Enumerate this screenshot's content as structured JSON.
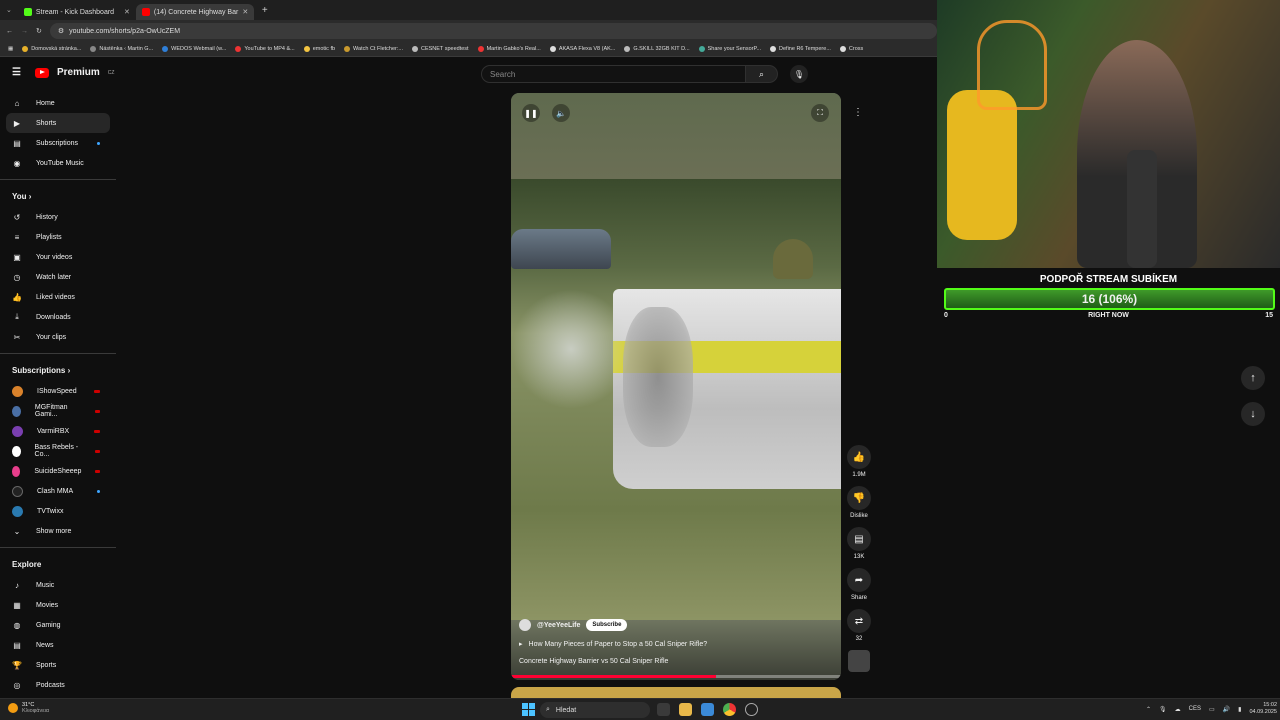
{
  "browser": {
    "tabs": [
      {
        "title": "Stream - Kick Dashboard",
        "icon": "kick-icon",
        "color": "#53fc18"
      },
      {
        "title": "(14) Concrete Highway Bar",
        "icon": "youtube-icon",
        "color": "#ff0000",
        "active": true
      }
    ],
    "url": "youtube.com/shorts/p2a-OwUcZEM",
    "bookmarks": [
      "Domovská stránka...",
      "Nástěnka ‹ Martin G...",
      "WEDOS Webmail (w...",
      "YouTube to MP4 &...",
      "emotic fb",
      "Watch Ct Fletcher:...",
      "CESNET speedtest",
      "Martin Gabko's Real...",
      "AKASA Flexa V8 (AK...",
      "G.SKILL 32GB KIT D...",
      "Share your SensorP...",
      "Define R6 Tempere...",
      "Cross"
    ]
  },
  "youtube": {
    "logo": "Premium",
    "logo_badge": "CZ",
    "search_placeholder": "Search",
    "nav_main": [
      {
        "label": "Home",
        "icon": "home-icon"
      },
      {
        "label": "Shorts",
        "icon": "shorts-icon",
        "active": true
      },
      {
        "label": "Subscriptions",
        "icon": "subscriptions-icon",
        "dot": true
      },
      {
        "label": "YouTube Music",
        "icon": "music-icon"
      }
    ],
    "you_header": "You",
    "nav_you": [
      {
        "label": "History",
        "icon": "history-icon"
      },
      {
        "label": "Playlists",
        "icon": "playlists-icon"
      },
      {
        "label": "Your videos",
        "icon": "your-videos-icon"
      },
      {
        "label": "Watch later",
        "icon": "watch-later-icon"
      },
      {
        "label": "Liked videos",
        "icon": "liked-icon"
      },
      {
        "label": "Downloads",
        "icon": "downloads-icon"
      },
      {
        "label": "Your clips",
        "icon": "clips-icon"
      }
    ],
    "subs_header": "Subscriptions",
    "subscriptions": [
      {
        "label": "IShowSpeed",
        "color": "#d9822b",
        "live": true
      },
      {
        "label": "MGFitman Gami...",
        "color": "#4a6fa5",
        "live": true
      },
      {
        "label": "VarmiRBX",
        "color": "#7a3fb0",
        "live": true
      },
      {
        "label": "Bass Rebels - Co...",
        "color": "#ffffff",
        "live": true
      },
      {
        "label": "SuicideSheeep",
        "color": "#e83e8c",
        "live": true
      },
      {
        "label": "Clash MMA",
        "color": "#222222",
        "dot": true
      },
      {
        "label": "TVTwixx",
        "color": "#2a7ab0"
      }
    ],
    "show_more": "Show more",
    "explore_header": "Explore",
    "nav_explore": [
      {
        "label": "Music",
        "icon": "music-note-icon"
      },
      {
        "label": "Movies",
        "icon": "movies-icon"
      },
      {
        "label": "Gaming",
        "icon": "gaming-icon"
      },
      {
        "label": "News",
        "icon": "news-icon"
      },
      {
        "label": "Sports",
        "icon": "sports-icon"
      },
      {
        "label": "Podcasts",
        "icon": "podcasts-icon"
      }
    ],
    "short": {
      "channel": "@YeeYeeLife",
      "subscribe": "Subscribe",
      "related": "How Many Pieces of Paper to Stop a 50 Cal Sniper Rifle?",
      "title": "Concrete Highway Barrier vs 50 Cal Sniper Rifle",
      "progress": 0.62
    },
    "actions": {
      "likes": "1.9M",
      "dislike": "Dislike",
      "comments": "13K",
      "share": "Share",
      "remix": "32"
    }
  },
  "stream_overlay": {
    "sub_goal_title": "PODPOŘ STREAM SUBÍKEM",
    "sub_goal_value": "16 (106%)",
    "sub_goal_fraction": 1.06,
    "sub_min": "0",
    "sub_label": "RIGHT NOW",
    "sub_max": "15"
  },
  "taskbar": {
    "weather_temp": "31°C",
    "weather_desc": "Κλιοφάνεια",
    "search": "Hledat",
    "lang": "CES",
    "time": "15:02",
    "date": "04.09.2025"
  }
}
